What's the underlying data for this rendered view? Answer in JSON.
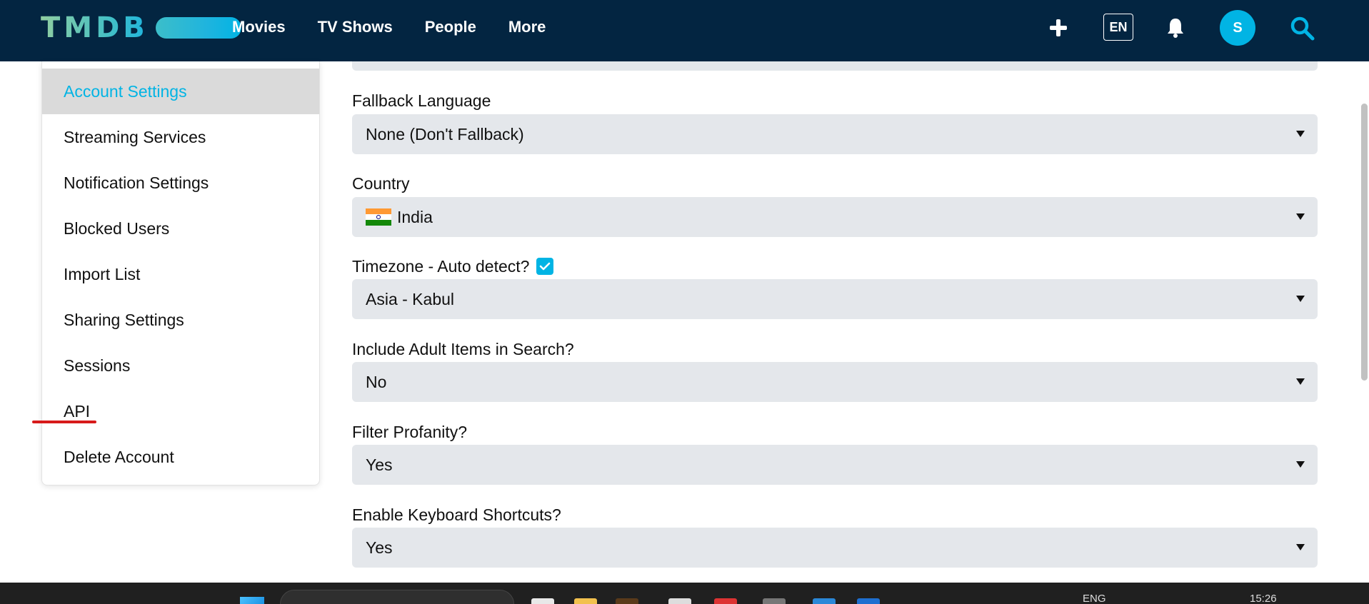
{
  "header": {
    "logo_text": "TMDB",
    "nav": [
      "Movies",
      "TV Shows",
      "People",
      "More"
    ],
    "language_button": "EN",
    "avatar_initial": "S",
    "icons": [
      "plus-icon",
      "bell-icon",
      "search-icon"
    ]
  },
  "sidebar": {
    "items": [
      {
        "label": "Account Settings",
        "active": true
      },
      {
        "label": "Streaming Services"
      },
      {
        "label": "Notification Settings"
      },
      {
        "label": "Blocked Users"
      },
      {
        "label": "Import List"
      },
      {
        "label": "Sharing Settings"
      },
      {
        "label": "Sessions"
      },
      {
        "label": "API"
      },
      {
        "label": "Delete Account"
      }
    ]
  },
  "form": {
    "fallback_language": {
      "label": "Fallback Language",
      "value": "None (Don't Fallback)"
    },
    "country": {
      "label": "Country",
      "value": "India",
      "flag_icon": "india-flag-icon"
    },
    "timezone": {
      "label": "Timezone - Auto detect?",
      "auto_detect": true,
      "value": "Asia - Kabul"
    },
    "adult_items": {
      "label": "Include Adult Items in Search?",
      "value": "No"
    },
    "filter_profanity": {
      "label": "Filter Profanity?",
      "value": "Yes"
    },
    "keyboard_shortcuts": {
      "label": "Enable Keyboard Shortcuts?",
      "value": "Yes"
    }
  },
  "taskbar": {
    "language": "ENG",
    "time": "15:26"
  },
  "colors": {
    "header_bg": "#032541",
    "accent": "#01b4e4",
    "field_bg": "#e4e7eb",
    "annotation_red": "#d71a1a"
  }
}
